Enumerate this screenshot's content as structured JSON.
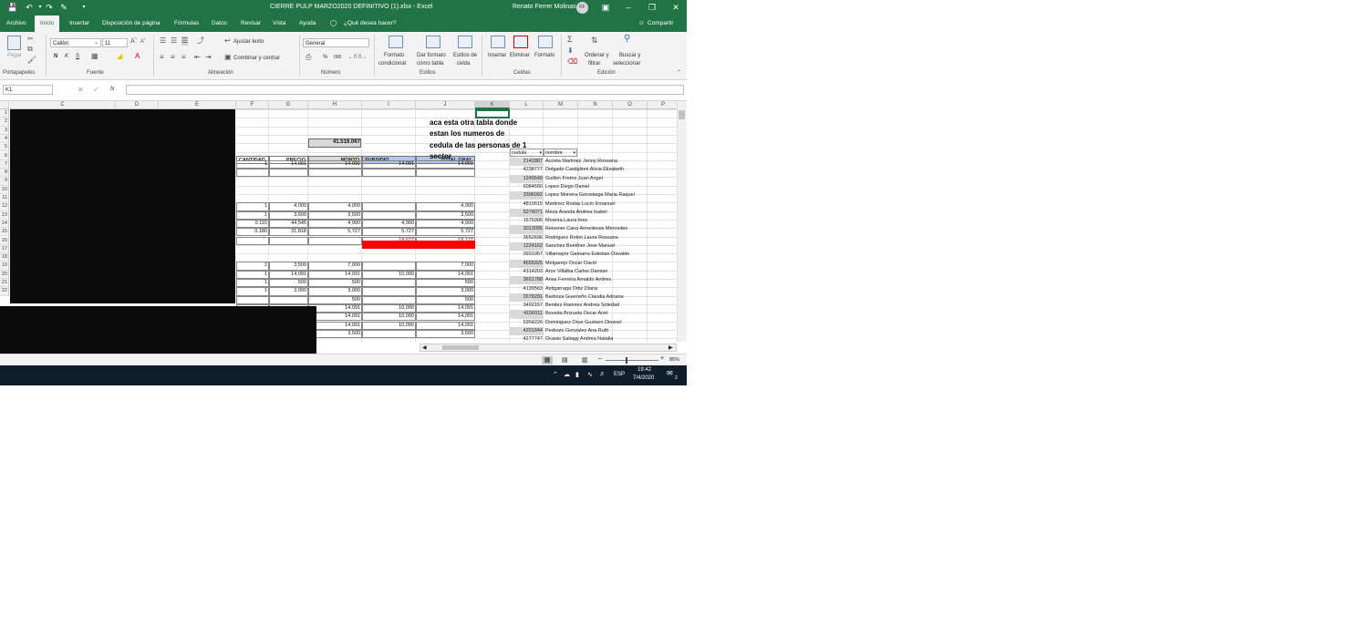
{
  "window": {
    "title": "CIERRE PULP MARZO2020 DEFINITIVO (1).xlsx  -  Excel",
    "user_name": "Renato Ferrer Molinas",
    "user_initials": "RF",
    "accent_color": "#217346"
  },
  "menu_tabs": [
    "Archivo",
    "Inicio",
    "Insertar",
    "Disposición de página",
    "Fórmulas",
    "Datos",
    "Revisar",
    "Vista",
    "Ayuda"
  ],
  "tell_me": "¿Qué desea hacer?",
  "share": "Compartir",
  "ribbon": {
    "paste": "Pegar",
    "font_name": "Calibri",
    "font_size": "11",
    "bold": "N",
    "italic": "K",
    "underline": "S",
    "wrap_text": "Ajustar texto",
    "merge_center": "Combinar y centrar",
    "number_format": "General",
    "percent": "%",
    "thousands": "000",
    "conditional_1": "Formato",
    "conditional_2": "condicional",
    "format_table_1": "Dar formato",
    "format_table_2": "como tabla",
    "cell_styles_1": "Estilos de",
    "cell_styles_2": "celda",
    "insert": "Insertar",
    "delete": "Eliminar",
    "format": "Formato",
    "sort_1": "Ordenar y",
    "sort_2": "filtrar",
    "find_1": "Buscar y",
    "find_2": "seleccionar",
    "groups": [
      "Portapapeles",
      "Fuente",
      "Alineación",
      "Número",
      "Estilos",
      "Celdas",
      "Edición"
    ]
  },
  "formula_bar": {
    "name_box": "K1",
    "fx": "fx",
    "formula": ""
  },
  "columns": [
    "C",
    "D",
    "E",
    "F",
    "G",
    "H",
    "I",
    "J",
    "K",
    "L",
    "M",
    "N",
    "O",
    "P"
  ],
  "rows": [
    "1",
    "2",
    "3",
    "4",
    "5",
    "6",
    "7",
    "8",
    "9",
    "10",
    "11",
    "12",
    "13",
    "14",
    "15",
    "16",
    "17",
    "18",
    "19",
    "20",
    "21",
    "22"
  ],
  "sheet": {
    "total_h4": "41.516.067",
    "headers": {
      "cantidad": "CANTIDAD",
      "precio": "PRECIO",
      "monto": "MONTO",
      "subsidio": "SUBSIDIO",
      "total": "TOTAL GRAL"
    },
    "data_rows": [
      {
        "row": 7,
        "f": "1",
        "g": "14,091",
        "h": "14,091",
        "i": "14,091",
        "j": "14,091"
      },
      {
        "row": 12,
        "f": "1",
        "g": "4,000",
        "h": "4,000",
        "i": "",
        "j": "4,000"
      },
      {
        "row": 13,
        "f": "1",
        "g": "3,500",
        "h": "3,500",
        "i": "",
        "j": "3,500"
      },
      {
        "row": 14,
        "f": "0.110",
        "g": "44,545",
        "h": "4,900",
        "i": "4,900",
        "j": "4,900"
      },
      {
        "row": 15,
        "f": "0.180",
        "g": "31,818",
        "h": "5,727",
        "i": "5,727",
        "j": "5,727"
      },
      {
        "row": 16,
        "f": "",
        "g": "",
        "h": "",
        "i": "18,627",
        "j": "18,127"
      },
      {
        "row": 19,
        "f": "2",
        "g": "3,500",
        "h": "7,000",
        "i": "",
        "j": "7,000"
      },
      {
        "row": 20,
        "f": "1",
        "g": "14,091",
        "h": "14,091",
        "i": "10,000",
        "j": "14,091"
      },
      {
        "row": 21,
        "f": "1",
        "g": "500",
        "h": "500",
        "i": "",
        "j": "500"
      },
      {
        "row": 22,
        "f": "1",
        "g": "3,000",
        "h": "3,000",
        "i": "",
        "j": "3,000"
      },
      {
        "row": 23,
        "f": "",
        "g": "",
        "h": "500",
        "i": "",
        "j": "500"
      },
      {
        "row": 24,
        "f": "",
        "g": "",
        "h": "14,091",
        "i": "10,000",
        "j": "14,091"
      },
      {
        "row": 25,
        "f": "",
        "g": "",
        "h": "14,091",
        "i": "10,000",
        "j": "14,091"
      },
      {
        "row": 26,
        "f": "",
        "g": "",
        "h": "14,091",
        "i": "10,000",
        "j": "14,091"
      },
      {
        "row": 27,
        "f": "",
        "g": "",
        "h": "3,500",
        "i": "",
        "j": "3,500"
      }
    ],
    "note_lines": [
      "aca esta otra tabla donde",
      "estan los numeros de",
      "cedula de las personas de 1",
      "sector"
    ],
    "list_headers": {
      "cedula": "cedula",
      "nombre": "nombre"
    },
    "people": [
      {
        "cedula": "2142887",
        "nombre": "Acosta Martinez Jenny Rossana"
      },
      {
        "cedula": "4238777",
        "nombre": "Delgado Castiglioni Alicia Elizabeth"
      },
      {
        "cedula": "1249549",
        "nombre": "Guillen Fretes Juan Angel"
      },
      {
        "cedula": "5084550",
        "nombre": "Lopez Diego Daniel"
      },
      {
        "cedula": "3396092",
        "nombre": "Lopez Moreira Gorostiaga Maria Raquel"
      },
      {
        "cedula": "4810615",
        "nombre": "Martinez Rodas Lucio Emanuel"
      },
      {
        "cedula": "5274071",
        "nombre": "Meza Aranda Andrea Isabel"
      },
      {
        "cedula": "1575306",
        "nombre": "Moreira Laura Ines"
      },
      {
        "cedula": "3013095",
        "nombre": "Reissner Cano Anneliesse Mercedes"
      },
      {
        "cedula": "3652696",
        "nombre": "Rodriguez Rolon Laura Rossana"
      },
      {
        "cedula": "1224162",
        "nombre": "Sanchez Boettner Jose Manuel"
      },
      {
        "cedula": "3931057",
        "nombre": "Villamayor Gamarra Esteban Osvaldo"
      },
      {
        "cedula": "4655925",
        "nombre": "Melgarejo Oscar David"
      },
      {
        "cedula": "4314203",
        "nombre": "Arce Villalba Carlos Damian"
      },
      {
        "cedula": "3651788",
        "nombre": "Arias Ferreira Arnaldo Andres"
      },
      {
        "cedula": "4139563",
        "nombre": "Astigarraga Ortiz Diana"
      },
      {
        "cedula": "2678291",
        "nombre": "Barboza Guerreño Claudia Adriana"
      },
      {
        "cedula": "3492157",
        "nombre": "Benitez Ramirez Andrea Soledad"
      },
      {
        "cedula": "4156011",
        "nombre": "Boveda Brizuela Oscar Ariel"
      },
      {
        "cedula": "5364226",
        "nombre": "Dominguez Orue Gustavo Diosnel"
      },
      {
        "cedula": "4201844",
        "nombre": "Pedrozo Gonzalez Ana Ruth"
      },
      {
        "cedula": "4277747",
        "nombre": "Ocasio Saliagy Andrea Natalia"
      }
    ]
  },
  "status_bar": {
    "zoom": "85%"
  },
  "taskbar": {
    "lang": "ESP",
    "time": "19:42",
    "date": "7/4/2020",
    "notif": "2"
  }
}
